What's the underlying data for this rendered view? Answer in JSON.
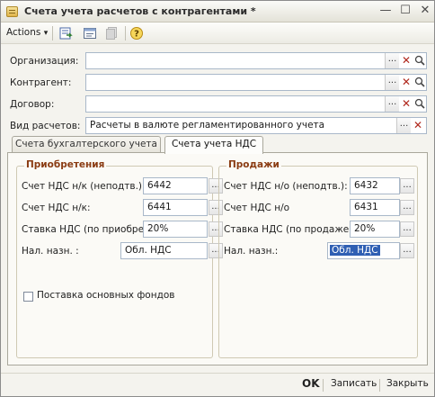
{
  "window": {
    "title": "Счета учета расчетов с контрагентами *"
  },
  "titlebar_buttons": {
    "minimize": "—",
    "maximize": "☐",
    "close": "✕"
  },
  "toolbar": {
    "actions_label": "Actions",
    "actions_arrow": "▾"
  },
  "form": {
    "organization": {
      "label": "Организация:",
      "value": ""
    },
    "counterparty": {
      "label": "Контрагент:",
      "value": ""
    },
    "contract": {
      "label": "Договор:",
      "value": ""
    },
    "settlement_type": {
      "label": "Вид расчетов:",
      "value": "Расчеты в валюте регламентированного учета"
    }
  },
  "tabs": [
    {
      "label": "Счета бухгалтерского учета",
      "active": false
    },
    {
      "label": "Счета учета НДС",
      "active": true
    }
  ],
  "purchases": {
    "title": "Приобретения",
    "rows": [
      {
        "label": "Счет НДС н/к (неподтв.):",
        "value": "6442"
      },
      {
        "label": "Счет НДС н/к:",
        "value": "6441"
      },
      {
        "label": "Ставка НДС (по приобре...",
        "value": "20%"
      },
      {
        "label": "Нал. назн. :",
        "value": "Обл. НДС"
      }
    ],
    "checkbox_label": "Поставка основных фондов"
  },
  "sales": {
    "title": "Продажи",
    "rows": [
      {
        "label": "Счет НДС н/о (неподтв.):",
        "value": "6432"
      },
      {
        "label": "Счет НДС н/о",
        "value": "6431"
      },
      {
        "label": "Ставка НДС (по продаже):",
        "value": "20%"
      },
      {
        "label": "Нал. назн.:",
        "value": "Обл. НДС"
      }
    ]
  },
  "footer": {
    "ok_label": "OK",
    "save_label": "Записать",
    "close_label": "Закрыть"
  },
  "icons": {
    "dots": "...",
    "clear": "✕",
    "window": "app-window-icon",
    "tb1": "post-document-icon",
    "tb2": "edit-form-icon",
    "tb3": "copy-icon",
    "help": "help-icon",
    "search": "magnifier-icon"
  },
  "colors": {
    "group_title": "#8a3b12",
    "selection": "#2f5fb3",
    "clear_red": "#b0271c"
  }
}
